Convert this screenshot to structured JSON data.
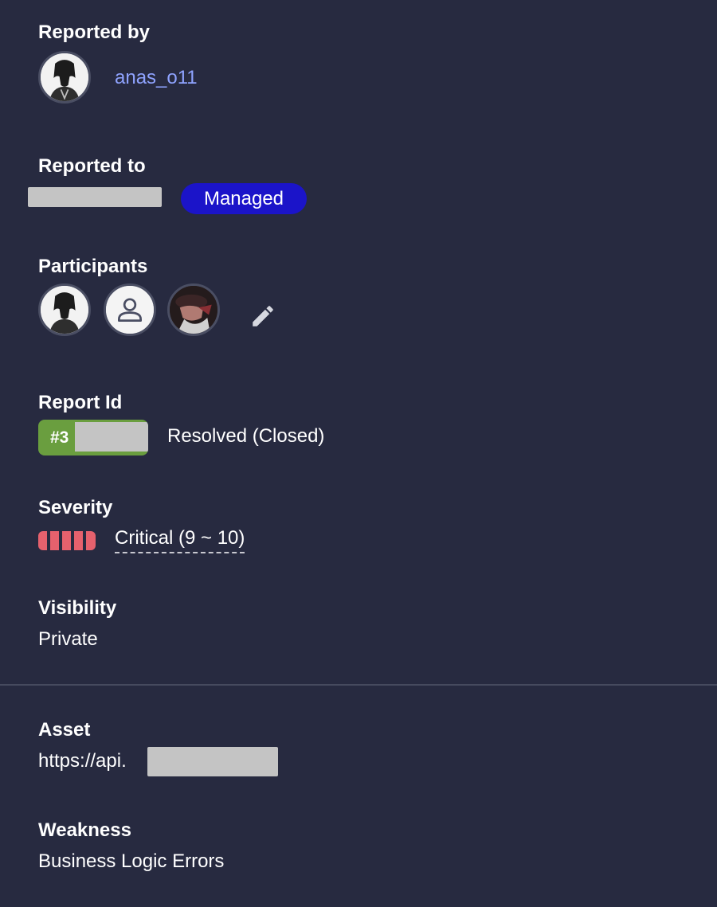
{
  "reported_by": {
    "label": "Reported by",
    "username": "anas_o11",
    "avatar_icon": "user-photo-avatar"
  },
  "reported_to": {
    "label": "Reported to",
    "badge": "Managed"
  },
  "participants": {
    "label": "Participants",
    "avatars": [
      "user-photo-avatar",
      "default-person-icon",
      "user-photo-avatar"
    ],
    "edit_icon": "pencil-icon"
  },
  "report": {
    "label": "Report Id",
    "id_prefix": "#3",
    "status": "Resolved (Closed)"
  },
  "severity": {
    "label": "Severity",
    "rating": "Critical (9 ~ 10)",
    "level_segments_filled": 5,
    "color": "#e5616d"
  },
  "visibility": {
    "label": "Visibility",
    "value": "Private"
  },
  "asset": {
    "label": "Asset",
    "value_prefix": "https://api."
  },
  "weakness": {
    "label": "Weakness",
    "value": "Business Logic Errors"
  },
  "colors": {
    "background": "#272a40",
    "link": "#8fa3ff",
    "managed_badge": "#1b14c9",
    "report_pill": "#6a9e3f"
  }
}
